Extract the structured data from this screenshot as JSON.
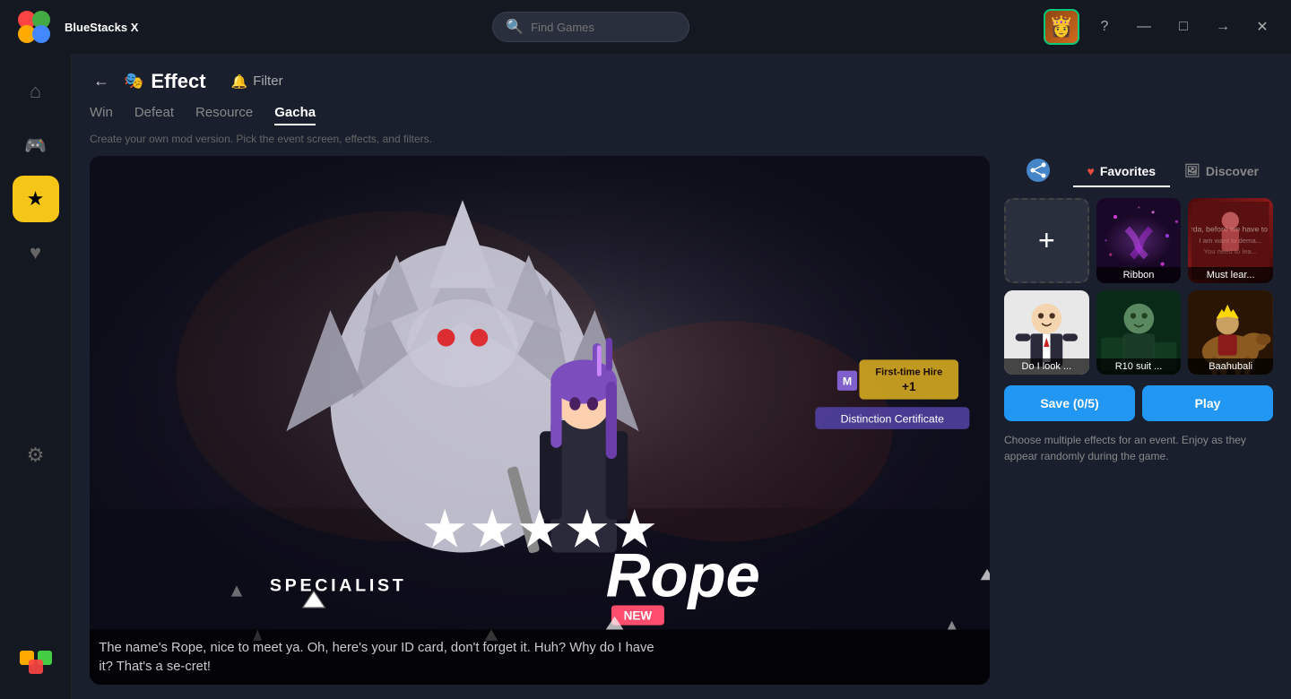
{
  "app": {
    "name": "BlueStacks X",
    "search_placeholder": "Find Games"
  },
  "title_bar": {
    "help_btn": "?",
    "minimize_btn": "—",
    "maximize_btn": "□",
    "forward_btn": "→",
    "close_btn": "✕"
  },
  "sidebar": {
    "items": [
      {
        "id": "home",
        "icon": "⌂",
        "label": "Home"
      },
      {
        "id": "games",
        "icon": "🎮",
        "label": "Games"
      },
      {
        "id": "effects",
        "icon": "★",
        "label": "Effects",
        "active": true
      },
      {
        "id": "favorites",
        "icon": "♥",
        "label": "Favorites"
      },
      {
        "id": "settings",
        "icon": "⚙",
        "label": "Settings"
      }
    ],
    "bottom_icon": "🟢"
  },
  "header": {
    "back_label": "←",
    "page_icon": "🎭",
    "page_title": "Effect",
    "filter_icon": "🔔",
    "filter_label": "Filter"
  },
  "tabs": {
    "items": [
      {
        "id": "win",
        "label": "Win",
        "active": false
      },
      {
        "id": "defeat",
        "label": "Defeat",
        "active": false
      },
      {
        "id": "resource",
        "label": "Resource",
        "active": false
      },
      {
        "id": "gacha",
        "label": "Gacha",
        "active": true
      }
    ],
    "description": "Create your own mod version. Pick the event screen, effects, and filters."
  },
  "game_preview": {
    "character_name": "Rope",
    "class_text": "SPECIALIST",
    "new_badge": "NEW",
    "stars": [
      "★",
      "★",
      "★",
      "★",
      "★"
    ],
    "subtitle": "The name's Rope, nice to meet ya. Oh, here's your ID card, don't forget it. Huh? Why do I have\nit? That's a se-cret!",
    "hire_badge": "First-time Hire\n+1",
    "distinction_badge": "Distinction Certificate"
  },
  "right_panel": {
    "share_icon": "share",
    "panel_tabs": [
      {
        "id": "favorites",
        "icon": "♥",
        "label": "Favorites",
        "active": true
      },
      {
        "id": "discover",
        "icon": "🖼",
        "label": "Discover",
        "active": false
      }
    ],
    "effect_cards": [
      {
        "id": "add",
        "type": "add",
        "label": "+"
      },
      {
        "id": "ribbon",
        "type": "ribbon",
        "label": "Ribbon"
      },
      {
        "id": "mustlear",
        "type": "must",
        "label": "Must lear..."
      },
      {
        "id": "dolook",
        "type": "dolook",
        "label": "Do I look ..."
      },
      {
        "id": "r10suit",
        "type": "r10",
        "label": "R10 suit ..."
      },
      {
        "id": "baahubali",
        "type": "baahubali",
        "label": "Baahubali"
      }
    ],
    "save_label": "Save (0/5)",
    "play_label": "Play",
    "description": "Choose multiple effects for an event. Enjoy as they appear randomly during the game."
  }
}
